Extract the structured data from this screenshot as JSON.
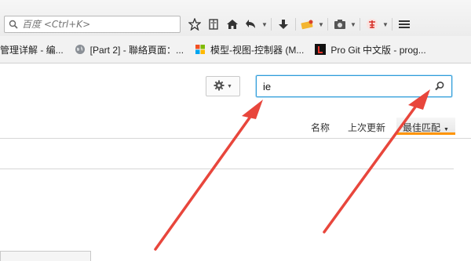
{
  "browser": {
    "search_placeholder": "百度 <Ctrl+K>",
    "toolbar_icons": [
      "star-icon",
      "reading-list-icon",
      "home-icon",
      "back-icon",
      "download-icon",
      "addon-icon",
      "screenshot-icon",
      "fortune-icon",
      "menu-icon"
    ]
  },
  "bookmarks": [
    {
      "label": "管理详解 - 编...",
      "icon": "none"
    },
    {
      "label": "[Part 2] - 聯絡頁面：...",
      "icon": "globe-icon"
    },
    {
      "label": "模型-视图-控制器 (M...",
      "icon": "windows-icon"
    },
    {
      "label": "Pro Git 中文版 - prog...",
      "icon": "l-icon"
    }
  ],
  "addons": {
    "search_value": "ie",
    "sort": {
      "name": "名称",
      "last_updated": "上次更新",
      "best_match": "最佳匹配"
    }
  },
  "colors": {
    "accent_blue": "#2f9cd9",
    "arrow_red": "#e8463c",
    "tab_orange": "#ff9400"
  }
}
